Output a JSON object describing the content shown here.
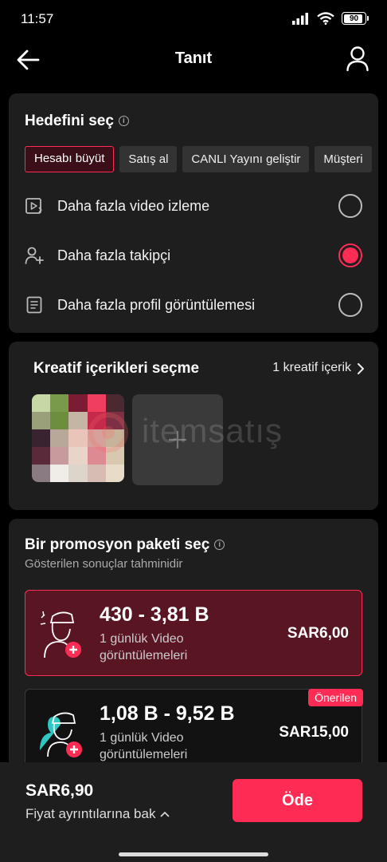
{
  "status_bar": {
    "time": "11:57",
    "battery": "90"
  },
  "nav": {
    "title": "Tanıt"
  },
  "goal": {
    "title": "Hedefini seç",
    "info_glyph": "i",
    "chips": [
      "Hesabı büyüt",
      "Satış al",
      "CANLI Yayını geliştir",
      "Müşteri"
    ],
    "active_chip_index": 0,
    "options": [
      {
        "label": "Daha fazla video izleme",
        "icon": "video-play-icon",
        "selected": false
      },
      {
        "label": "Daha fazla takipçi",
        "icon": "user-plus-icon",
        "selected": true
      },
      {
        "label": "Daha fazla profil görüntülemesi",
        "icon": "document-icon",
        "selected": false
      }
    ]
  },
  "creatives": {
    "title": "Kreatif içerikleri seçme",
    "count_link": "1 kreatif içerik",
    "add_glyph": "+"
  },
  "watermark": {
    "text": "itemsatış"
  },
  "packages": {
    "title": "Bir promosyon paketi seç",
    "info_glyph": "i",
    "subtitle": "Gösterilen sonuçlar tahminidir",
    "items": [
      {
        "range": "430 - 3,81 B",
        "description": "1 günlük Video görüntülemeleri",
        "price": "SAR6,00",
        "selected": true,
        "badge": ""
      },
      {
        "range": "1,08 B - 9,52 B",
        "description": "1 günlük Video görüntülemeleri",
        "price": "SAR15,00",
        "selected": false,
        "badge": "Önerilen"
      }
    ]
  },
  "footer": {
    "total": "SAR6,90",
    "details_link": "Fiyat ayrıntılarına bak",
    "pay_label": "Öde"
  },
  "colors": {
    "accent": "#fe2c55",
    "card": "#1e1e1e",
    "background": "#000000",
    "selected_package": "#5a1523"
  }
}
